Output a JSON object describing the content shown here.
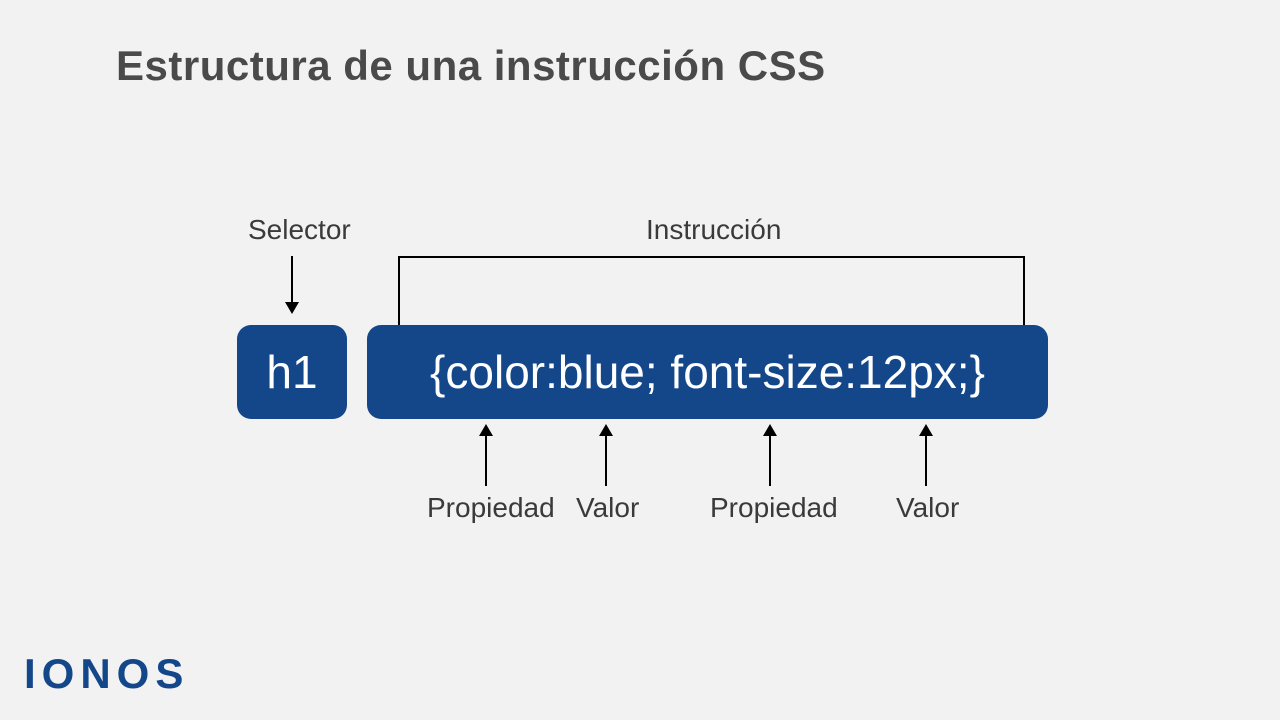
{
  "title": "Estructura de una instrucción CSS",
  "labels": {
    "selector": "Selector",
    "instruction": "Instrucción",
    "property1": "Propiedad",
    "value1": "Valor",
    "property2": "Propiedad",
    "value2": "Valor"
  },
  "code": {
    "selector": "h1",
    "instruction": "{color:blue; font-size:12px;}"
  },
  "brand": "IONOS",
  "colors": {
    "box_bg": "#14468a",
    "page_bg": "#f2f2f2"
  }
}
